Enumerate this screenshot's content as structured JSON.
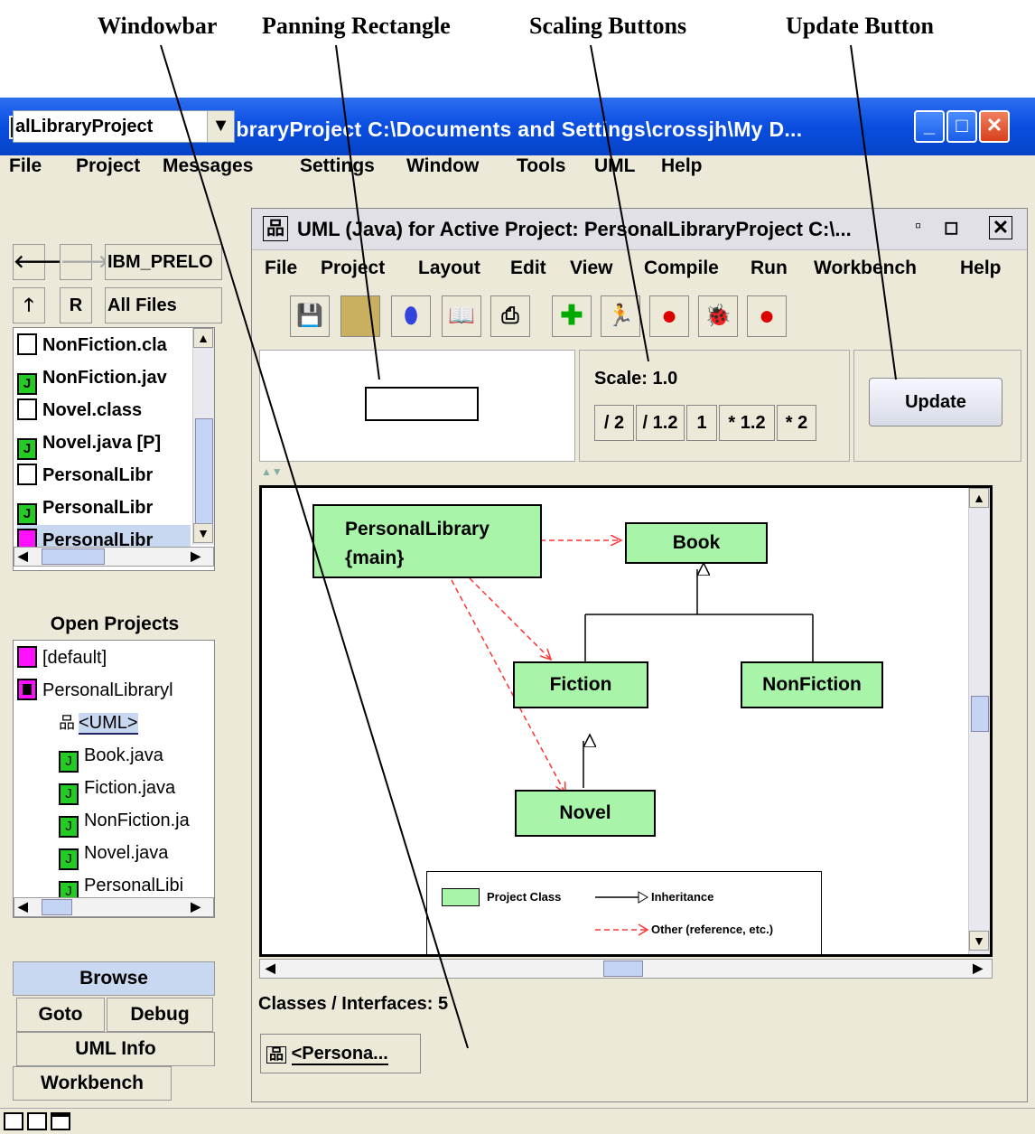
{
  "annotations": {
    "windowbar": "Windowbar",
    "panning_rectangle": "Panning Rectangle",
    "scaling_buttons": "Scaling Buttons",
    "update_button": "Update Button"
  },
  "window": {
    "title": "Project: PersonalLibraryProject  C:\\Documents and Settings\\crossjh\\My D...",
    "app_icon": "G"
  },
  "menubar": [
    "File",
    "Project",
    "Messages",
    "Settings",
    "Window",
    "Tools",
    "UML",
    "Help"
  ],
  "browse": {
    "project_combo": "alLibraryProject",
    "nav_location": "IBM_PRELO",
    "up_label": "R",
    "filter": "All Files",
    "files": [
      {
        "name": "NonFiction.cla",
        "icon": "file"
      },
      {
        "name": "NonFiction.jav",
        "icon": "java"
      },
      {
        "name": "Novel.class",
        "icon": "file"
      },
      {
        "name": "Novel.java [P]",
        "icon": "java"
      },
      {
        "name": "PersonalLibr",
        "icon": "file"
      },
      {
        "name": "PersonalLibr",
        "icon": "java"
      },
      {
        "name": "PersonalLibr",
        "icon": "project"
      }
    ],
    "open_projects_header": "Open Projects",
    "open_projects": [
      {
        "name": "[default]",
        "icon": "project",
        "indent": 0
      },
      {
        "name": "PersonalLibraryl",
        "icon": "project-active",
        "indent": 0
      },
      {
        "name": "<UML>",
        "icon": "uml",
        "indent": 1
      },
      {
        "name": "Book.java",
        "icon": "java",
        "indent": 1
      },
      {
        "name": "Fiction.java",
        "icon": "java",
        "indent": 1
      },
      {
        "name": "NonFiction.ja",
        "icon": "java",
        "indent": 1
      },
      {
        "name": "Novel.java",
        "icon": "java",
        "indent": 1
      },
      {
        "name": "PersonalLibi",
        "icon": "java",
        "indent": 1
      }
    ],
    "tabs": {
      "browse": "Browse",
      "goto": "Goto",
      "debug": "Debug",
      "uml_info": "UML Info",
      "workbench": "Workbench"
    }
  },
  "uml_window": {
    "title": "UML (Java) for Active Project: PersonalLibraryProject  C:\\...",
    "menu": [
      "File",
      "Project",
      "Layout",
      "Edit",
      "View",
      "Compile",
      "Run",
      "Workbench",
      "Help"
    ],
    "toolbar_icons": [
      "save-icon",
      "open-folder-icon",
      "jar-icon",
      "book-icon",
      "print-icon",
      "add-icon",
      "run-icon",
      "compile-apple-icon",
      "debug-ladybug-icon",
      "compile-all-apple-icon"
    ],
    "scale_label": "Scale: 1.0",
    "scale_buttons": [
      "/ 2",
      "/ 1.2",
      "1",
      "* 1.2",
      "* 2"
    ],
    "update_label": "Update",
    "status": "Classes / Interfaces: 5",
    "task_button": "<Persona..."
  },
  "diagram": {
    "classes": {
      "personal_library": "PersonalLibrary\n{main}",
      "book": "Book",
      "fiction": "Fiction",
      "nonfiction": "NonFiction",
      "novel": "Novel"
    },
    "legend": {
      "project_class": "Project Class",
      "inheritance": "Inheritance",
      "other": "Other (reference, etc.)"
    },
    "colors": {
      "class_fill": "#a8f4a8",
      "dependency": "#ff3333",
      "selected_project": "#ff11ff",
      "java_icon": "#22cc22"
    }
  }
}
